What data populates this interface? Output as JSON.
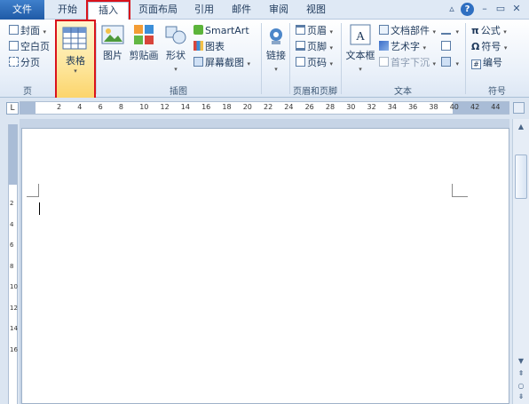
{
  "tabs": [
    {
      "label": "文件",
      "id": "file"
    },
    {
      "label": "开始",
      "id": "home"
    },
    {
      "label": "插入",
      "id": "insert"
    },
    {
      "label": "页面布局",
      "id": "layout"
    },
    {
      "label": "引用",
      "id": "references"
    },
    {
      "label": "邮件",
      "id": "mailings"
    },
    {
      "label": "审阅",
      "id": "review"
    },
    {
      "label": "视图",
      "id": "view"
    }
  ],
  "window": {
    "minimize": "▵",
    "help": "?",
    "restore": "▭",
    "close": "✕"
  },
  "ribbon": {
    "pages": {
      "cover": "封面",
      "blank": "空白页",
      "break": "分页",
      "label": "页"
    },
    "table": {
      "button": "表格",
      "label": "表格"
    },
    "illustrations": {
      "picture": "图片",
      "clipart": "剪贴画",
      "shapes": "形状",
      "smartart": "SmartArt",
      "chart": "图表",
      "screenshot": "屏幕截图",
      "label": "插图"
    },
    "links": {
      "button": "链接"
    },
    "header_footer": {
      "header": "页眉",
      "footer": "页脚",
      "page_number": "页码",
      "label": "页眉和页脚"
    },
    "text": {
      "textbox": "文本框",
      "quickparts": "文档部件",
      "wordart": "艺术字",
      "dropcap": "首字下沉",
      "label": "文本"
    },
    "symbols": {
      "equation": "公式",
      "symbol": "符号",
      "number": "编号",
      "label": "符号"
    }
  },
  "ruler": {
    "corner": "L",
    "marks": [
      "2",
      "4",
      "6",
      "8",
      "10",
      "12",
      "14",
      "16",
      "18",
      "20",
      "22",
      "24",
      "26",
      "28",
      "30",
      "32",
      "34",
      "36",
      "38",
      "40",
      "42",
      "44"
    ],
    "vmarks": [
      "2",
      "4",
      "6",
      "8",
      "10",
      "12",
      "14",
      "16"
    ]
  }
}
